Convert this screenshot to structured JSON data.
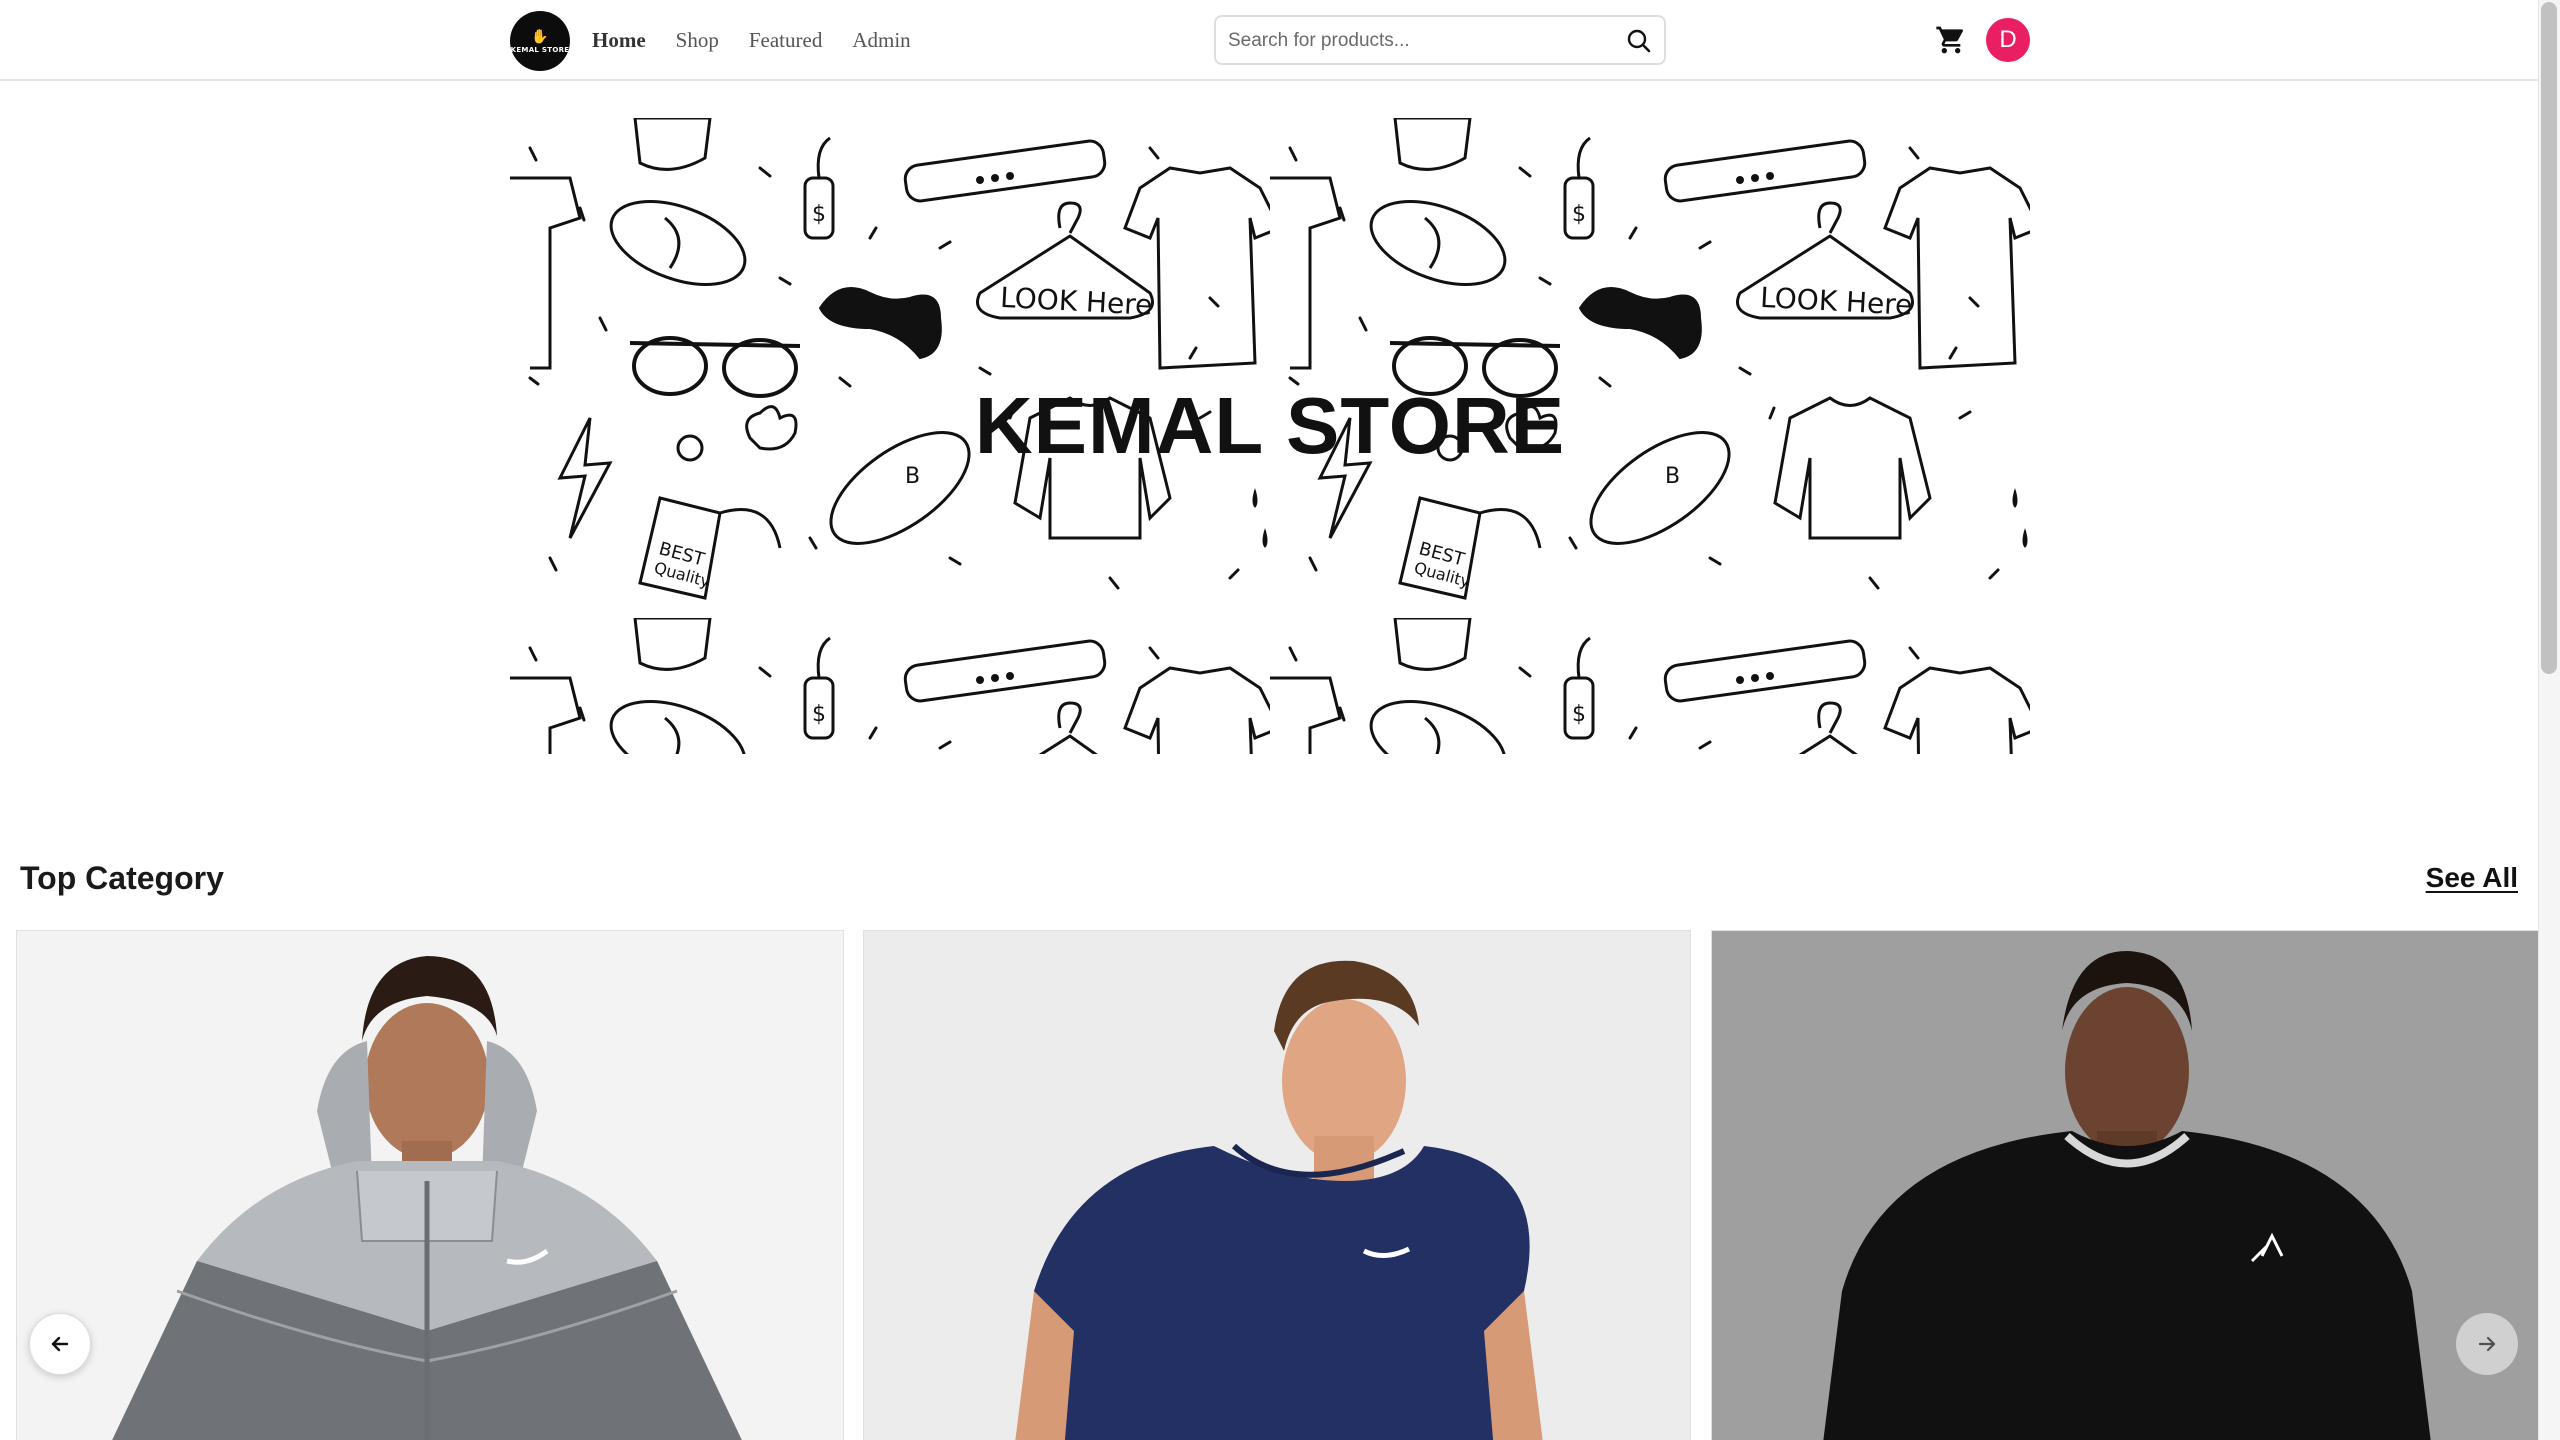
{
  "brand": {
    "logo_text": "KEMAL STORE"
  },
  "nav": {
    "links": [
      {
        "label": "Home",
        "active": true
      },
      {
        "label": "Shop",
        "active": false
      },
      {
        "label": "Featured",
        "active": false
      },
      {
        "label": "Admin",
        "active": false
      }
    ]
  },
  "search": {
    "placeholder": "Search for products...",
    "value": ""
  },
  "user": {
    "avatar_initial": "D",
    "avatar_color": "#e91e63"
  },
  "icons": {
    "search": "search-icon",
    "cart": "shopping-cart-icon",
    "prev": "arrow-left-icon",
    "next": "arrow-right-icon"
  },
  "hero": {
    "title": "KEMAL STORE"
  },
  "category": {
    "title": "Top Category",
    "see_all": "See All",
    "cards": [
      {
        "product": "puffer-jacket",
        "background": "#f3f3f3"
      },
      {
        "product": "navy-tshirt",
        "background": "#ececec"
      },
      {
        "product": "black-sweatshirt",
        "background": "#9f9f9f"
      }
    ]
  }
}
